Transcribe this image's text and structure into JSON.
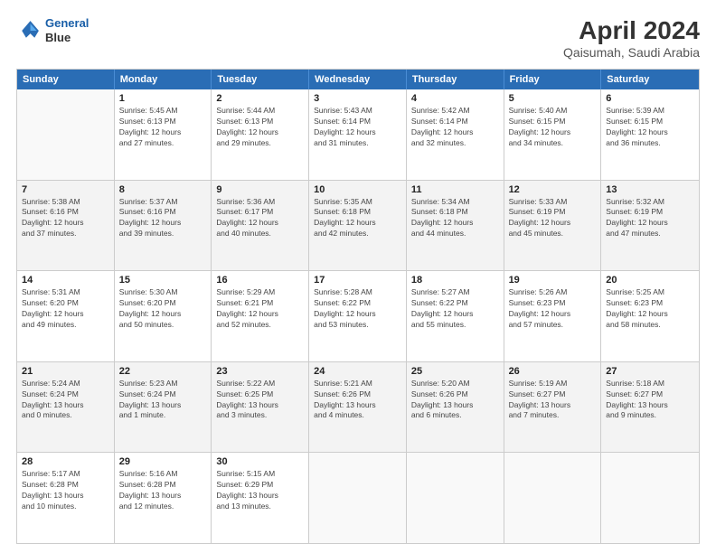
{
  "header": {
    "logo_line1": "General",
    "logo_line2": "Blue",
    "title": "April 2024",
    "subtitle": "Qaisumah, Saudi Arabia"
  },
  "weekdays": [
    "Sunday",
    "Monday",
    "Tuesday",
    "Wednesday",
    "Thursday",
    "Friday",
    "Saturday"
  ],
  "rows": [
    [
      {
        "day": "",
        "info": ""
      },
      {
        "day": "1",
        "info": "Sunrise: 5:45 AM\nSunset: 6:13 PM\nDaylight: 12 hours\nand 27 minutes."
      },
      {
        "day": "2",
        "info": "Sunrise: 5:44 AM\nSunset: 6:13 PM\nDaylight: 12 hours\nand 29 minutes."
      },
      {
        "day": "3",
        "info": "Sunrise: 5:43 AM\nSunset: 6:14 PM\nDaylight: 12 hours\nand 31 minutes."
      },
      {
        "day": "4",
        "info": "Sunrise: 5:42 AM\nSunset: 6:14 PM\nDaylight: 12 hours\nand 32 minutes."
      },
      {
        "day": "5",
        "info": "Sunrise: 5:40 AM\nSunset: 6:15 PM\nDaylight: 12 hours\nand 34 minutes."
      },
      {
        "day": "6",
        "info": "Sunrise: 5:39 AM\nSunset: 6:15 PM\nDaylight: 12 hours\nand 36 minutes."
      }
    ],
    [
      {
        "day": "7",
        "info": "Sunrise: 5:38 AM\nSunset: 6:16 PM\nDaylight: 12 hours\nand 37 minutes."
      },
      {
        "day": "8",
        "info": "Sunrise: 5:37 AM\nSunset: 6:16 PM\nDaylight: 12 hours\nand 39 minutes."
      },
      {
        "day": "9",
        "info": "Sunrise: 5:36 AM\nSunset: 6:17 PM\nDaylight: 12 hours\nand 40 minutes."
      },
      {
        "day": "10",
        "info": "Sunrise: 5:35 AM\nSunset: 6:18 PM\nDaylight: 12 hours\nand 42 minutes."
      },
      {
        "day": "11",
        "info": "Sunrise: 5:34 AM\nSunset: 6:18 PM\nDaylight: 12 hours\nand 44 minutes."
      },
      {
        "day": "12",
        "info": "Sunrise: 5:33 AM\nSunset: 6:19 PM\nDaylight: 12 hours\nand 45 minutes."
      },
      {
        "day": "13",
        "info": "Sunrise: 5:32 AM\nSunset: 6:19 PM\nDaylight: 12 hours\nand 47 minutes."
      }
    ],
    [
      {
        "day": "14",
        "info": "Sunrise: 5:31 AM\nSunset: 6:20 PM\nDaylight: 12 hours\nand 49 minutes."
      },
      {
        "day": "15",
        "info": "Sunrise: 5:30 AM\nSunset: 6:20 PM\nDaylight: 12 hours\nand 50 minutes."
      },
      {
        "day": "16",
        "info": "Sunrise: 5:29 AM\nSunset: 6:21 PM\nDaylight: 12 hours\nand 52 minutes."
      },
      {
        "day": "17",
        "info": "Sunrise: 5:28 AM\nSunset: 6:22 PM\nDaylight: 12 hours\nand 53 minutes."
      },
      {
        "day": "18",
        "info": "Sunrise: 5:27 AM\nSunset: 6:22 PM\nDaylight: 12 hours\nand 55 minutes."
      },
      {
        "day": "19",
        "info": "Sunrise: 5:26 AM\nSunset: 6:23 PM\nDaylight: 12 hours\nand 57 minutes."
      },
      {
        "day": "20",
        "info": "Sunrise: 5:25 AM\nSunset: 6:23 PM\nDaylight: 12 hours\nand 58 minutes."
      }
    ],
    [
      {
        "day": "21",
        "info": "Sunrise: 5:24 AM\nSunset: 6:24 PM\nDaylight: 13 hours\nand 0 minutes."
      },
      {
        "day": "22",
        "info": "Sunrise: 5:23 AM\nSunset: 6:24 PM\nDaylight: 13 hours\nand 1 minute."
      },
      {
        "day": "23",
        "info": "Sunrise: 5:22 AM\nSunset: 6:25 PM\nDaylight: 13 hours\nand 3 minutes."
      },
      {
        "day": "24",
        "info": "Sunrise: 5:21 AM\nSunset: 6:26 PM\nDaylight: 13 hours\nand 4 minutes."
      },
      {
        "day": "25",
        "info": "Sunrise: 5:20 AM\nSunset: 6:26 PM\nDaylight: 13 hours\nand 6 minutes."
      },
      {
        "day": "26",
        "info": "Sunrise: 5:19 AM\nSunset: 6:27 PM\nDaylight: 13 hours\nand 7 minutes."
      },
      {
        "day": "27",
        "info": "Sunrise: 5:18 AM\nSunset: 6:27 PM\nDaylight: 13 hours\nand 9 minutes."
      }
    ],
    [
      {
        "day": "28",
        "info": "Sunrise: 5:17 AM\nSunset: 6:28 PM\nDaylight: 13 hours\nand 10 minutes."
      },
      {
        "day": "29",
        "info": "Sunrise: 5:16 AM\nSunset: 6:28 PM\nDaylight: 13 hours\nand 12 minutes."
      },
      {
        "day": "30",
        "info": "Sunrise: 5:15 AM\nSunset: 6:29 PM\nDaylight: 13 hours\nand 13 minutes."
      },
      {
        "day": "",
        "info": ""
      },
      {
        "day": "",
        "info": ""
      },
      {
        "day": "",
        "info": ""
      },
      {
        "day": "",
        "info": ""
      }
    ]
  ]
}
